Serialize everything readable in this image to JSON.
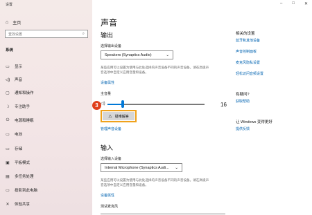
{
  "window": {
    "title": "设置",
    "minimize": "–",
    "maximize": "□",
    "close": "✕"
  },
  "sidebar": {
    "home": "主页",
    "search_placeholder": "查找设置",
    "section": "系统",
    "items": [
      {
        "label": "显示",
        "icon": "display-icon",
        "glyph": "▭"
      },
      {
        "label": "声音",
        "icon": "speaker-icon",
        "glyph": "◁)"
      },
      {
        "label": "通知和操作",
        "icon": "notification-icon",
        "glyph": "▢"
      },
      {
        "label": "专注助手",
        "icon": "moon-icon",
        "glyph": "☽"
      },
      {
        "label": "电源和睡眠",
        "icon": "power-icon",
        "glyph": "⏻"
      },
      {
        "label": "电池",
        "icon": "battery-icon",
        "glyph": "▭"
      },
      {
        "label": "存储",
        "icon": "storage-icon",
        "glyph": "▭"
      },
      {
        "label": "平板模式",
        "icon": "tablet-icon",
        "glyph": "▣"
      },
      {
        "label": "多任务处理",
        "icon": "multitask-icon",
        "glyph": "▤"
      },
      {
        "label": "投影到此电脑",
        "icon": "project-icon",
        "glyph": "▭"
      },
      {
        "label": "体验共享",
        "icon": "share-icon",
        "glyph": "✕"
      }
    ]
  },
  "main": {
    "title": "声音",
    "output": {
      "heading": "输出",
      "device_label": "选择输出设备",
      "device_value": "Speakers (Synaptics Audio)",
      "desc": "某些应用可以设置为使用与此处选择的声音设备不同的声音设备。请在高级声音选项中自定义应用音量和设备。",
      "props_link": "设备属性",
      "volume_label": "主音量",
      "volume": 16,
      "volume_max": 100,
      "troubleshoot": "疑难解答",
      "manage_link": "管理声音设备"
    },
    "step_badge": "3",
    "input": {
      "heading": "输入",
      "device_label": "选择输入设备",
      "device_value": "Internal Microphone (Synaptics Audi...",
      "desc": "某些应用可以设置为使用与此处选择的声音设备不同的声音设备。请在高级声音选项中自定义应用音量和设备。",
      "props_link": "设备属性",
      "test_label": "测试麦克风"
    }
  },
  "right": {
    "related_title": "相关的设置",
    "related_links": [
      "蓝牙和其他设备",
      "声音控制面板",
      "麦克风隐私设置",
      "轻松访问音频设置"
    ],
    "help_title": "有疑问?",
    "help_link": "获取帮助",
    "improve_title": "让 Windows 变得更好",
    "improve_link": "提供反馈"
  },
  "colors": {
    "accent": "#0078d7",
    "link": "#0063b1",
    "highlight": "#f0a21c",
    "badge": "#e0401c"
  }
}
